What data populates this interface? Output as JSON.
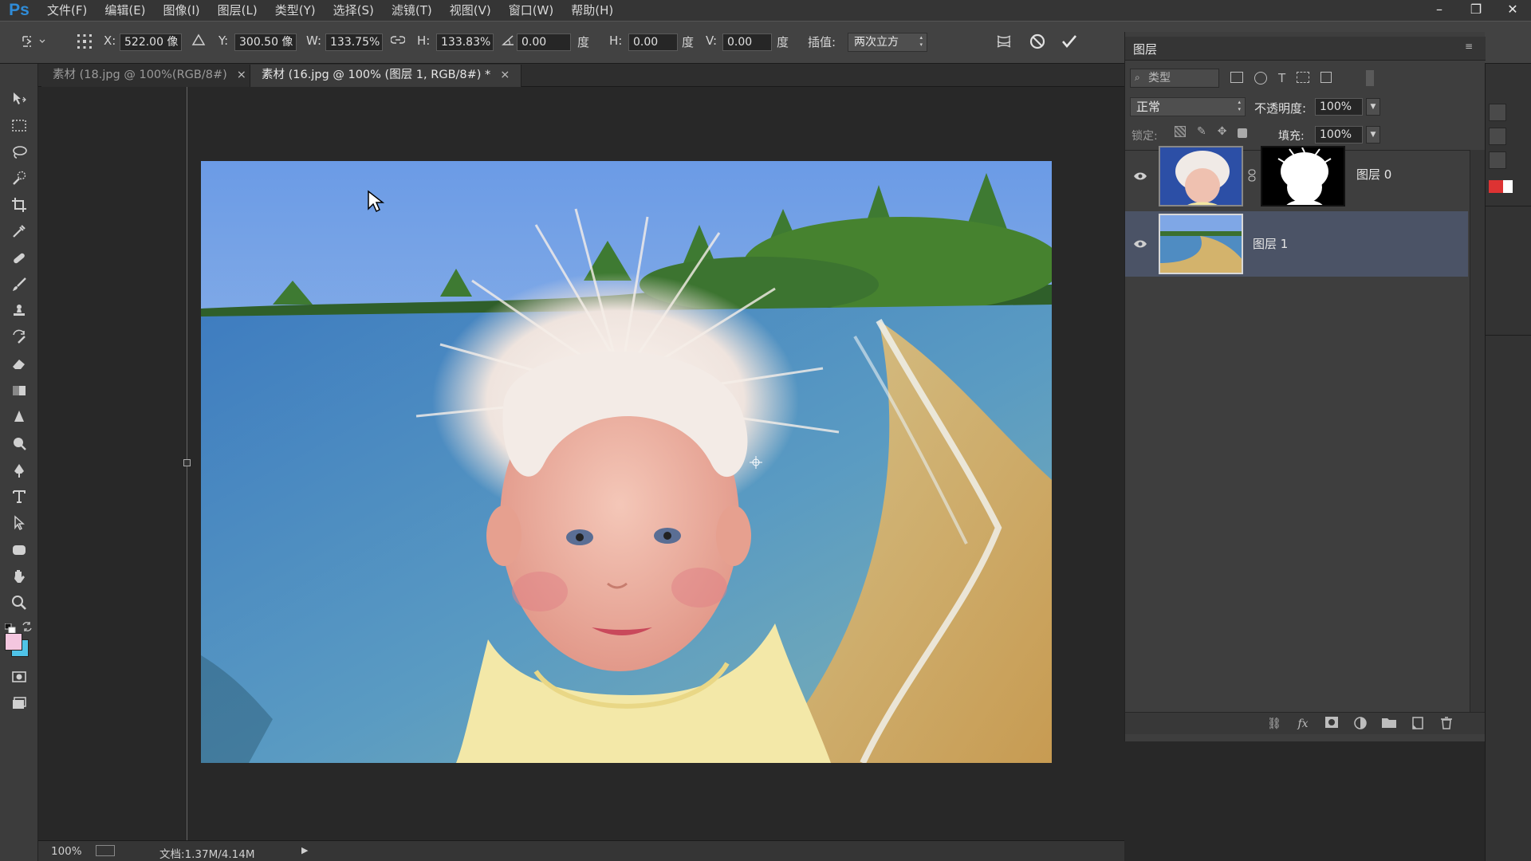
{
  "app": {
    "logo": "Ps"
  },
  "menu": [
    "文件(F)",
    "编辑(E)",
    "图像(I)",
    "图层(L)",
    "类型(Y)",
    "选择(S)",
    "滤镜(T)",
    "视图(V)",
    "窗口(W)",
    "帮助(H)"
  ],
  "window_controls": {
    "minimize": "–",
    "restore": "❐",
    "close": "✕"
  },
  "options": {
    "x_label": "X:",
    "x_value": "522.00 像",
    "y_label": "Y:",
    "y_value": "300.50 像",
    "w_label": "W:",
    "w_value": "133.75%",
    "h_label": "H:",
    "h_value": "133.83%",
    "angle_value": "0.00",
    "angle_unit": "度",
    "hskew_label": "H:",
    "hskew_value": "0.00",
    "hskew_unit": "度",
    "vskew_label": "V:",
    "vskew_value": "0.00",
    "vskew_unit": "度",
    "interp_label": "插值:",
    "interp_value": "两次立方"
  },
  "tabs": [
    {
      "label": "素材 (18.jpg @ 100%(RGB/8#)",
      "close": "×",
      "active": false
    },
    {
      "label": "素材 (16.jpg @ 100% (图层 1, RGB/8#) *",
      "close": "×",
      "active": true
    }
  ],
  "status": {
    "zoom": "100%",
    "doc": "文档:1.37M/4.14M"
  },
  "layers_panel": {
    "title": "图层",
    "filter_kind": "类型",
    "blend_mode": "正常",
    "opacity_label": "不透明度:",
    "opacity_value": "100%",
    "lock_label": "锁定:",
    "fill_label": "填充:",
    "fill_value": "100%",
    "layers": [
      {
        "name": "图层 0",
        "visible": true,
        "selected": false,
        "has_mask": true
      },
      {
        "name": "图层 1",
        "visible": true,
        "selected": true,
        "has_mask": false
      }
    ],
    "footer_icons": [
      "link-icon",
      "fx-icon",
      "mask-icon",
      "adjustment-icon",
      "folder-icon",
      "new-layer-icon",
      "trash-icon"
    ]
  },
  "colors": {
    "accent": "#2f8cd8",
    "foreground_color": "#f4c6df",
    "background_color": "#4fc3e8",
    "selected_row": "#4b5366"
  }
}
